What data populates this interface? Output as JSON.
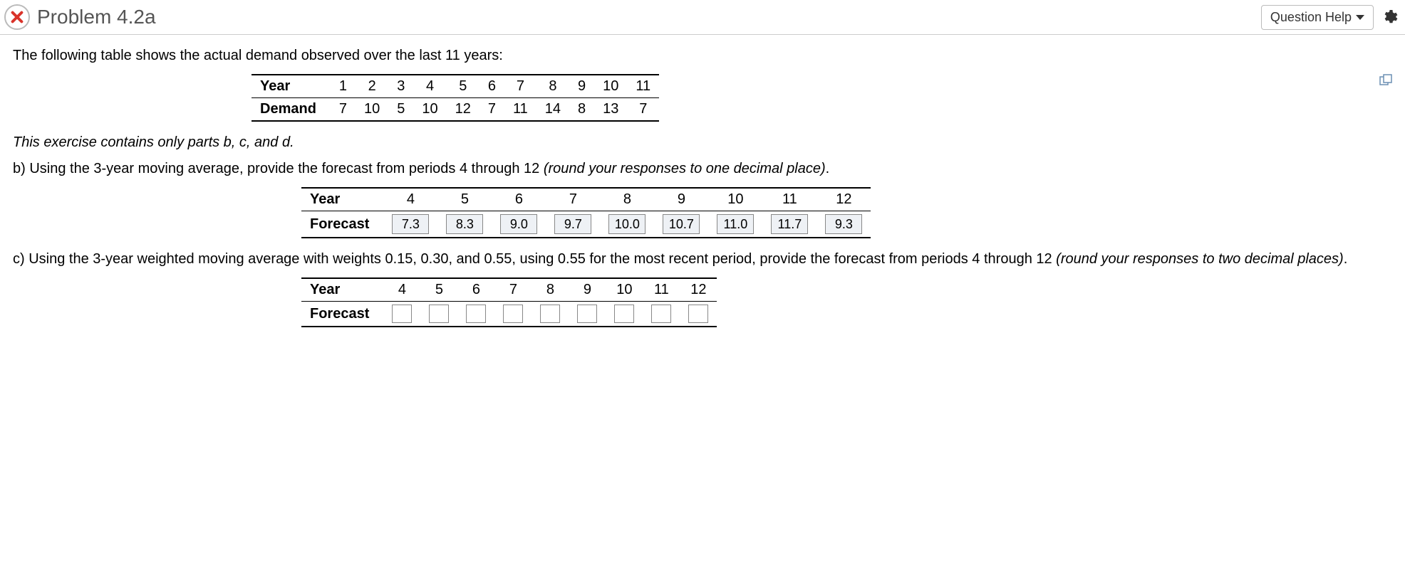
{
  "header": {
    "title": "Problem 4.2a",
    "help_label": "Question Help"
  },
  "intro": "The following table shows the actual demand observed over the last 11 years:",
  "table1": {
    "row_labels": [
      "Year",
      "Demand"
    ],
    "years": [
      "1",
      "2",
      "3",
      "4",
      "5",
      "6",
      "7",
      "8",
      "9",
      "10",
      "11"
    ],
    "demand": [
      "7",
      "10",
      "5",
      "10",
      "12",
      "7",
      "11",
      "14",
      "8",
      "13",
      "7"
    ]
  },
  "note": "This exercise contains only parts b, c, and d.",
  "part_b": {
    "prompt_prefix": "b) Using the 3-year moving average, provide the forecast from periods 4 through 12 ",
    "prompt_italic": "(round your responses to one decimal place)",
    "period": "."
  },
  "table2": {
    "row_labels": [
      "Year",
      "Forecast"
    ],
    "years": [
      "4",
      "5",
      "6",
      "7",
      "8",
      "9",
      "10",
      "11",
      "12"
    ],
    "forecast": [
      "7.3",
      "8.3",
      "9.0",
      "9.7",
      "10.0",
      "10.7",
      "11.0",
      "11.7",
      "9.3"
    ]
  },
  "part_c": {
    "prompt_prefix": "c) Using the 3-year weighted moving average with weights 0.15, 0.30, and 0.55, using 0.55 for the most recent period, provide the forecast from periods 4 through 12 ",
    "prompt_italic": "(round your responses to two decimal places)",
    "period": "."
  },
  "table3": {
    "row_labels": [
      "Year",
      "Forecast"
    ],
    "years": [
      "4",
      "5",
      "6",
      "7",
      "8",
      "9",
      "10",
      "11",
      "12"
    ]
  },
  "chart_data": [
    {
      "type": "table",
      "title": "Actual demand by year",
      "categories": [
        "1",
        "2",
        "3",
        "4",
        "5",
        "6",
        "7",
        "8",
        "9",
        "10",
        "11"
      ],
      "series": [
        {
          "name": "Demand",
          "values": [
            7,
            10,
            5,
            10,
            12,
            7,
            11,
            14,
            8,
            13,
            7
          ]
        }
      ]
    },
    {
      "type": "table",
      "title": "3-year moving-average forecast",
      "categories": [
        "4",
        "5",
        "6",
        "7",
        "8",
        "9",
        "10",
        "11",
        "12"
      ],
      "series": [
        {
          "name": "Forecast",
          "values": [
            7.3,
            8.3,
            9.0,
            9.7,
            10.0,
            10.7,
            11.0,
            11.7,
            9.3
          ]
        }
      ]
    }
  ]
}
